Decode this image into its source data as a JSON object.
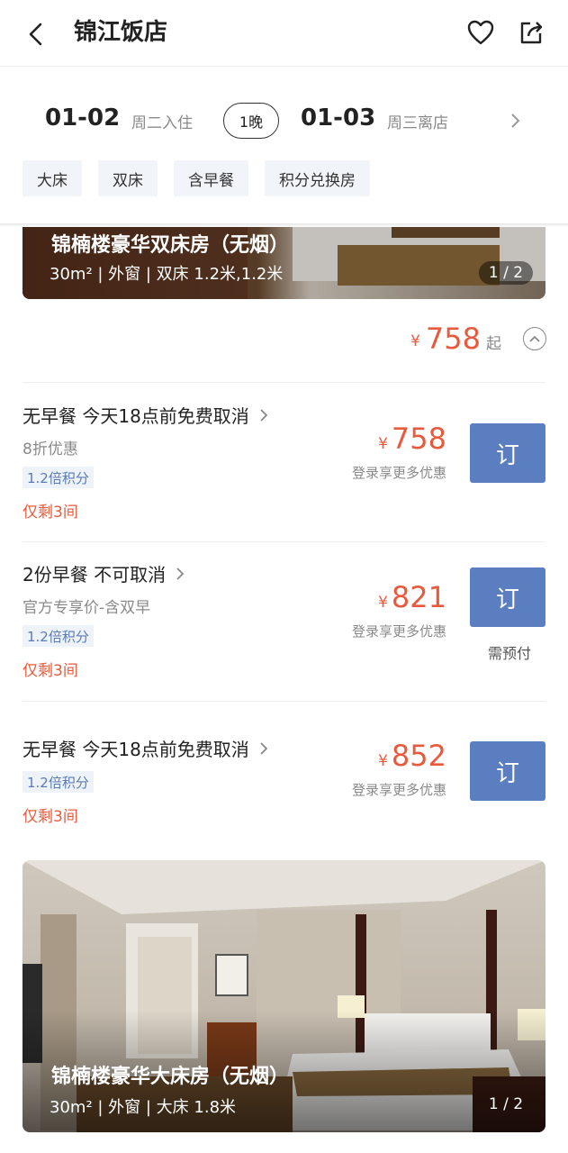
{
  "header": {
    "title": "锦江饭店"
  },
  "dates": {
    "checkin_date": "01-02",
    "checkin_label": "周二入住",
    "nights": "1晚",
    "checkout_date": "01-03",
    "checkout_label": "周三离店"
  },
  "filters": [
    "大床",
    "双床",
    "含早餐",
    "积分兑换房"
  ],
  "rooms": [
    {
      "name": "锦楠楼豪华双床房（无烟）",
      "info": "30m² | 外窗 | 双床 1.2米,1.2米",
      "counter": "1 / 2",
      "from_price": {
        "yen": "¥",
        "value": "758",
        "suffix": "起"
      },
      "offers": [
        {
          "title": "无早餐  今天18点前免费取消",
          "sub": "8折优惠",
          "tag": "1.2倍积分",
          "left": "仅剩3间",
          "yen": "¥",
          "price": "758",
          "note": "登录享更多优惠",
          "book": "订"
        },
        {
          "title": "2份早餐  不可取消",
          "sub": "官方专享价-含双早",
          "tag": "1.2倍积分",
          "left": "仅剩3间",
          "yen": "¥",
          "price": "821",
          "note": "登录享更多优惠",
          "book": "订",
          "prepay": "需预付"
        },
        {
          "title": "无早餐  今天18点前免费取消",
          "tag": "1.2倍积分",
          "left": "仅剩3间",
          "yen": "¥",
          "price": "852",
          "note": "登录享更多优惠",
          "book": "订"
        }
      ]
    },
    {
      "name": "锦楠楼豪华大床房（无烟）",
      "info": "30m² | 外窗 | 大床 1.8米",
      "counter": "1 / 2"
    }
  ],
  "colors": {
    "accent_red": "#e85a3d",
    "book_blue": "#5b7ec1",
    "tag_blue": "#5a7bb7"
  }
}
